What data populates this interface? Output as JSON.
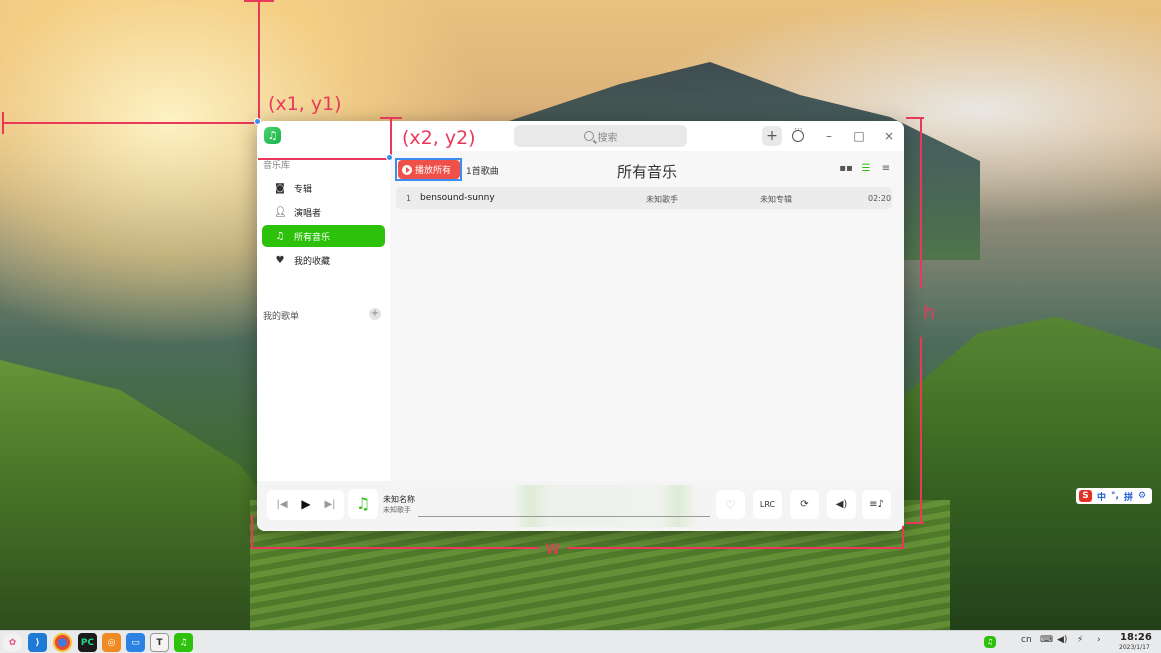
{
  "annotations": {
    "point1": "(x1, y1)",
    "point2": "(x2, y2)",
    "height_label": "h",
    "width_label": "w"
  },
  "app": {
    "search_placeholder": "搜索",
    "add_label": "+",
    "min_label": "–",
    "max_label": "□",
    "close_label": "×",
    "sidebar": {
      "library_header": "音乐库",
      "items": [
        {
          "label": "专辑",
          "icon": "album-icon"
        },
        {
          "label": "演唱者",
          "icon": "artist-icon"
        },
        {
          "label": "所有音乐",
          "icon": "music-note-icon",
          "active": true
        },
        {
          "label": "我的收藏",
          "icon": "heart-icon"
        }
      ],
      "playlists_header": "我的歌单"
    },
    "main": {
      "play_all_label": "播放所有",
      "song_count": "1首歌曲",
      "title": "所有音乐",
      "tracks": [
        {
          "index": "1",
          "title": "bensound-sunny",
          "artist": "未知歌手",
          "album": "未知专辑",
          "duration": "02:20"
        }
      ]
    },
    "player": {
      "title": "未知名称",
      "artist": "未知歌手",
      "lrc_label": "LRC"
    }
  },
  "ime": {
    "lang": "中",
    "symbol": "°,",
    "pinyin": "拼"
  },
  "taskbar": {
    "lang": "cn",
    "time": "18:26",
    "date": "2023/1/17"
  },
  "colors": {
    "accent_green": "#2ec10c",
    "play_all_red": "#f0504a",
    "annotation_red": "#e8395a"
  }
}
